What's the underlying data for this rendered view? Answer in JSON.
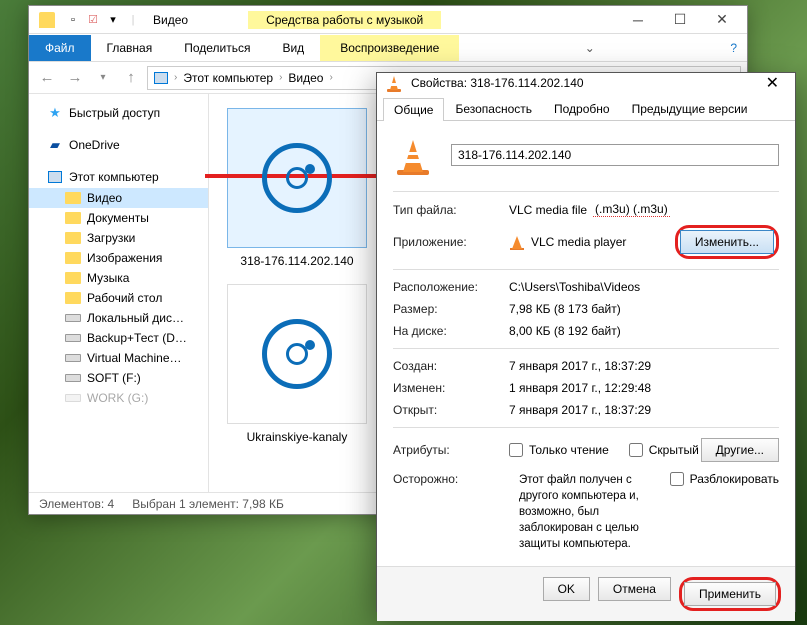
{
  "explorer": {
    "title": "Видео",
    "music_tools": "Средства работы с музыкой",
    "ribbon": {
      "file": "Файл",
      "home": "Главная",
      "share": "Поделиться",
      "view": "Вид",
      "playback": "Воспроизведение"
    },
    "breadcrumb": {
      "pc": "Этот компьютер",
      "folder": "Видео"
    },
    "sidebar": {
      "quick": "Быстрый доступ",
      "onedrive": "OneDrive",
      "pc": "Этот компьютер",
      "video": "Видео",
      "documents": "Документы",
      "downloads": "Загрузки",
      "images": "Изображения",
      "music": "Музыка",
      "desktop": "Рабочий стол",
      "local": "Локальный дис…",
      "backup": "Backup+Тест (D…",
      "vm": "Virtual Machine…",
      "soft": "SOFT (F:)",
      "work": "WORK (G:)"
    },
    "files": {
      "f1": "318-176.114.202.140",
      "f2": "Ukrainskiye-kanaly"
    },
    "status": {
      "count": "Элементов: 4",
      "sel": "Выбран 1 элемент: 7,98 КБ"
    }
  },
  "props": {
    "title": "Свойства: 318-176.114.202.140",
    "tabs": {
      "general": "Общие",
      "security": "Безопасность",
      "details": "Подробно",
      "prev": "Предыдущие версии"
    },
    "filename": "318-176.114.202.140",
    "labels": {
      "type": "Тип файла:",
      "app": "Приложение:",
      "location": "Расположение:",
      "size": "Размер:",
      "disk": "На диске:",
      "created": "Создан:",
      "modified": "Изменен:",
      "opened": "Открыт:",
      "attrs": "Атрибуты:",
      "warn": "Осторожно:"
    },
    "values": {
      "type_prefix": "VLC media file",
      "type_m3u": "(.m3u) (.m3u)",
      "app": "VLC media player",
      "location": "C:\\Users\\Toshiba\\Videos",
      "size": "7,98 КБ (8 173 байт)",
      "disk": "8,00 КБ (8 192 байт)",
      "created": "7 января 2017 г., 18:37:29",
      "modified": "1 января 2017 г., 12:29:48",
      "opened": "7 января 2017 г., 18:37:29",
      "readonly": "Только чтение",
      "hidden": "Скрытый",
      "warn_text": "Этот файл получен с другого компьютера и, возможно, был заблокирован с целью защиты компьютера.",
      "unblock": "Разблокировать"
    },
    "buttons": {
      "change": "Изменить...",
      "other": "Другие...",
      "ok": "OK",
      "cancel": "Отмена",
      "apply": "Применить"
    }
  }
}
